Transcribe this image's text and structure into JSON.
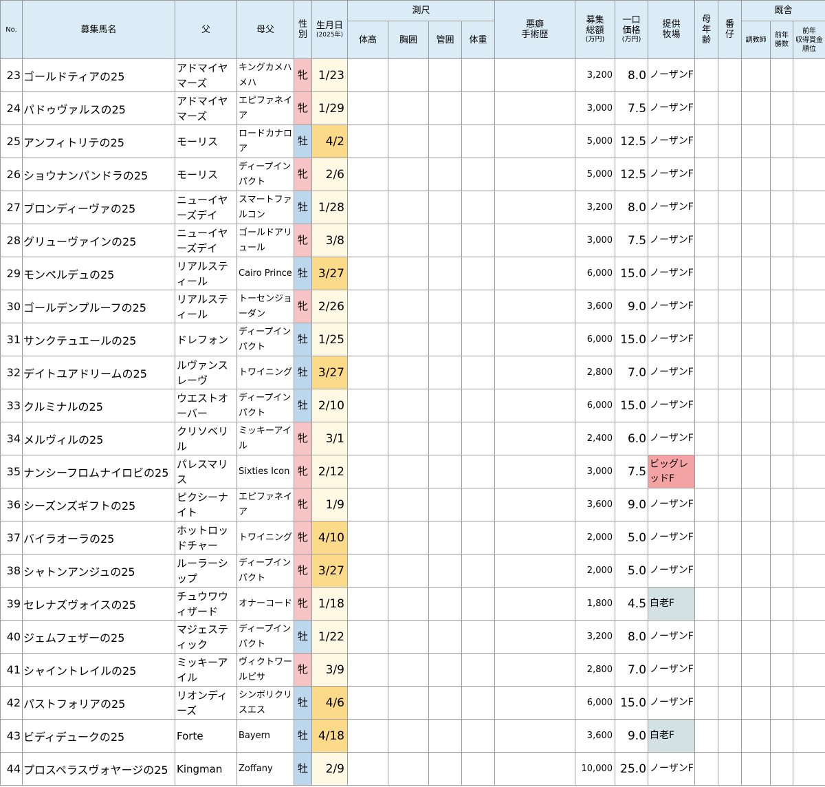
{
  "headers": {
    "no": "No.",
    "horse": "募集馬名",
    "sire": "父",
    "damsire": "母父",
    "sex": "性別",
    "birth": "生月日",
    "birth_sub": "(2025年)",
    "measure": "測尺",
    "height": "体高",
    "girth": "胸囲",
    "cannon": "管囲",
    "weight": "体重",
    "vice": "悪癖\n手術歴",
    "total": "募集\n総額",
    "total_unit": "(万円)",
    "unit_price": "一口\n価格",
    "unit_price_unit": "(万円)",
    "farm": "提供\n牧場",
    "dam_age": "母\n年\n齢",
    "parity": "番\n仔",
    "stable": "厩舎",
    "trainer": "調教師",
    "prev_wins": "前年\n勝数",
    "prev_rank": "前年\n収得賞金\n順位"
  },
  "rows": [
    {
      "no": "23",
      "name": "ゴールドティアの25",
      "sire": "アドマイヤマーズ",
      "damsire": "キングカメハメハ",
      "sex": "牝",
      "birth": "1/23",
      "total": "3,200",
      "price": "8.0",
      "farm": "ノーザンF"
    },
    {
      "no": "24",
      "name": "パドゥヴァルスの25",
      "sire": "アドマイヤマーズ",
      "damsire": "エピファネイア",
      "sex": "牝",
      "birth": "1/29",
      "total": "3,000",
      "price": "7.5",
      "farm": "ノーザンF"
    },
    {
      "no": "25",
      "name": "アンフィトリテの25",
      "sire": "モーリス",
      "damsire": "ロードカナロア",
      "sex": "牡",
      "birth": "4/2",
      "total": "5,000",
      "price": "12.5",
      "farm": "ノーザンF"
    },
    {
      "no": "26",
      "name": "ショウナンパンドラの25",
      "sire": "モーリス",
      "damsire": "ディープインパクト",
      "sex": "牝",
      "birth": "2/6",
      "total": "5,000",
      "price": "12.5",
      "farm": "ノーザンF"
    },
    {
      "no": "27",
      "name": "ブロンディーヴァの25",
      "sire": "ニューイヤーズデイ",
      "damsire": "スマートファルコン",
      "sex": "牡",
      "birth": "1/28",
      "total": "3,200",
      "price": "8.0",
      "farm": "ノーザンF"
    },
    {
      "no": "28",
      "name": "グリューヴァインの25",
      "sire": "ニューイヤーズデイ",
      "damsire": "ゴールドアリュール",
      "sex": "牝",
      "birth": "3/8",
      "total": "3,000",
      "price": "7.5",
      "farm": "ノーザンF"
    },
    {
      "no": "29",
      "name": "モンペルデュの25",
      "sire": "リアルスティール",
      "damsire": "Cairo Prince",
      "sex": "牡",
      "birth": "3/27",
      "total": "6,000",
      "price": "15.0",
      "farm": "ノーザンF"
    },
    {
      "no": "30",
      "name": "ゴールデンプルーフの25",
      "sire": "リアルスティール",
      "damsire": "トーセンジョーダン",
      "sex": "牝",
      "birth": "2/26",
      "total": "3,600",
      "price": "9.0",
      "farm": "ノーザンF"
    },
    {
      "no": "31",
      "name": "サンクテュエールの25",
      "sire": "ドレフォン",
      "damsire": "ディープインパクト",
      "sex": "牡",
      "birth": "1/25",
      "total": "6,000",
      "price": "15.0",
      "farm": "ノーザンF"
    },
    {
      "no": "32",
      "name": "デイトユアドリームの25",
      "sire": "ルヴァンスレーヴ",
      "damsire": "トワイニング",
      "sex": "牡",
      "birth": "3/27",
      "total": "2,800",
      "price": "7.0",
      "farm": "ノーザンF"
    },
    {
      "no": "33",
      "name": "クルミナルの25",
      "sire": "ウエストオーバー",
      "damsire": "ディープインパクト",
      "sex": "牡",
      "birth": "2/10",
      "total": "6,000",
      "price": "15.0",
      "farm": "ノーザンF"
    },
    {
      "no": "34",
      "name": "メルヴィルの25",
      "sire": "クリソベリル",
      "damsire": "ミッキーアイル",
      "sex": "牝",
      "birth": "3/1",
      "total": "2,400",
      "price": "6.0",
      "farm": "ノーザンF"
    },
    {
      "no": "35",
      "name": "ナンシーフロムナイロビの25",
      "sire": "パレスマリス",
      "damsire": "Sixties Icon",
      "sex": "牝",
      "birth": "2/12",
      "total": "3,000",
      "price": "7.5",
      "farm": "ビッグレッドF"
    },
    {
      "no": "36",
      "name": "シーズンズギフトの25",
      "sire": "ピクシーナイト",
      "damsire": "エピファネイア",
      "sex": "牝",
      "birth": "1/9",
      "total": "3,600",
      "price": "9.0",
      "farm": "ノーザンF"
    },
    {
      "no": "37",
      "name": "バイラオーラの25",
      "sire": "ホットロッドチャー",
      "damsire": "トワイニング",
      "sex": "牝",
      "birth": "4/10",
      "total": "2,000",
      "price": "5.0",
      "farm": "ノーザンF"
    },
    {
      "no": "38",
      "name": "シャトンアンジュの25",
      "sire": "ルーラーシップ",
      "damsire": "ディープインパクト",
      "sex": "牝",
      "birth": "3/27",
      "total": "2,000",
      "price": "5.0",
      "farm": "ノーザンF"
    },
    {
      "no": "39",
      "name": "セレナズヴォイスの25",
      "sire": "チュウワウィザード",
      "damsire": "オナーコード",
      "sex": "牝",
      "birth": "1/18",
      "total": "1,800",
      "price": "4.5",
      "farm": "白老F"
    },
    {
      "no": "40",
      "name": "ジェムフェザーの25",
      "sire": "マジェスティック",
      "damsire": "ディープインパクト",
      "sex": "牡",
      "birth": "1/22",
      "total": "3,200",
      "price": "8.0",
      "farm": "ノーザンF"
    },
    {
      "no": "41",
      "name": "シャイントレイルの25",
      "sire": "ミッキーアイル",
      "damsire": "ヴィクトワールピサ",
      "sex": "牝",
      "birth": "3/9",
      "total": "2,800",
      "price": "7.0",
      "farm": "ノーザンF"
    },
    {
      "no": "42",
      "name": "パストフォリアの25",
      "sire": "リオンディーズ",
      "damsire": "シンボリクリスエス",
      "sex": "牡",
      "birth": "4/6",
      "total": "6,000",
      "price": "15.0",
      "farm": "ノーザンF"
    },
    {
      "no": "43",
      "name": "ビディデュークの25",
      "sire": "Forte",
      "damsire": "Bayern",
      "sex": "牡",
      "birth": "4/18",
      "total": "3,600",
      "price": "9.0",
      "farm": "白老F"
    },
    {
      "no": "44",
      "name": "プロスペラスヴォヤージの25",
      "sire": "Kingman",
      "damsire": "Zoffany",
      "sex": "牡",
      "birth": "2/9",
      "total": "10,000",
      "price": "25.0",
      "farm": "ノーザンF"
    }
  ],
  "colors": {
    "header_bg": "#dcecf7",
    "filly": "#f6c4c4",
    "colt": "#bcd6ee",
    "birth_early": "#fff8e3",
    "birth_late": "#fbdb8a",
    "farm_bigred": "#f4a3a4",
    "farm_shiraoi": "#d3e1e2"
  }
}
